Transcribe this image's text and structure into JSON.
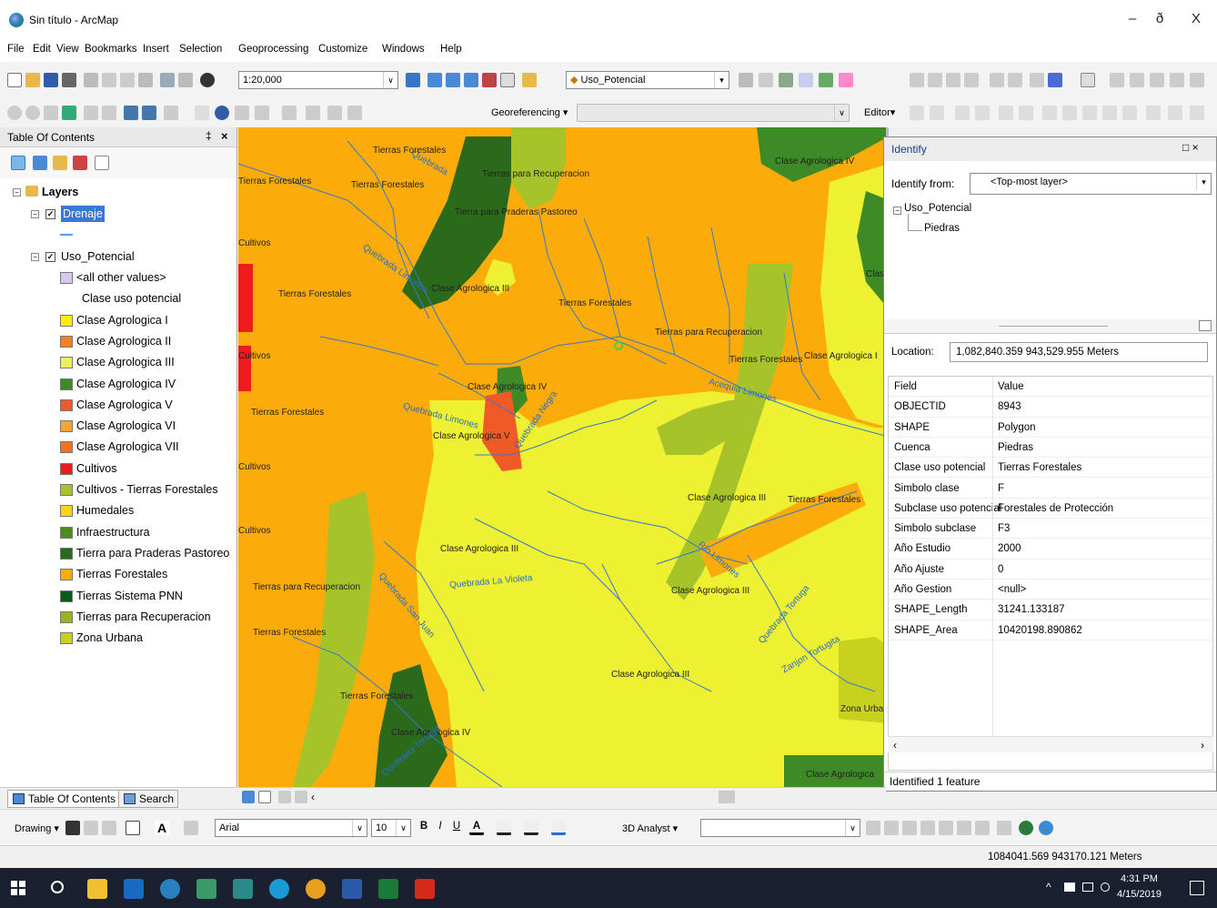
{
  "window": {
    "title": "Sin título - ArcMap",
    "minimize": "–",
    "maximize": "ð",
    "close": "X"
  },
  "menu": [
    "File",
    "Edit",
    "View",
    "Bookmarks",
    "Insert",
    "Selection",
    "Geoprocessing",
    "Customize",
    "Windows",
    "Help"
  ],
  "toolbar": {
    "scale": "1:20,000",
    "layer": "Uso_Potencial",
    "georef_label": "Georeferencing ▾",
    "editor_label": "Editor▾"
  },
  "toc": {
    "title": "Table Of Contents",
    "pin": "‡",
    "close": "×",
    "layers_label": "Layers",
    "layer1": "Drenaje",
    "layer2": "Uso_Potencial",
    "legend_heading": "Clase uso potencial",
    "legend": [
      {
        "label": "<all other values>",
        "color": "#d8c8f0"
      },
      {
        "label": "Clase Agrologica I",
        "color": "#ffee00"
      },
      {
        "label": "Clase Agrologica II",
        "color": "#f2821e"
      },
      {
        "label": "Clase Agrologica III",
        "color": "#e8f060"
      },
      {
        "label": "Clase Agrologica IV",
        "color": "#3d8a26"
      },
      {
        "label": "Clase Agrologica V",
        "color": "#f05a28"
      },
      {
        "label": "Clase Agrologica VI",
        "color": "#f7a23a"
      },
      {
        "label": "Clase Agrologica VII",
        "color": "#f0741e"
      },
      {
        "label": "Cultivos",
        "color": "#ee1c1c"
      },
      {
        "label": "Cultivos - Tierras Forestales",
        "color": "#a6c42a"
      },
      {
        "label": "Humedales",
        "color": "#ffd21e"
      },
      {
        "label": "Infraestructura",
        "color": "#4e8a1e"
      },
      {
        "label": "Tierra para Praderas Pastoreo",
        "color": "#2a6a1a"
      },
      {
        "label": "Tierras Forestales",
        "color": "#fbac0a"
      },
      {
        "label": "Tierras Sistema PNN",
        "color": "#0a5a1a"
      },
      {
        "label": "Tierras para Recuperacion",
        "color": "#9ab41e"
      },
      {
        "label": "Zona Urbana",
        "color": "#c8d21e"
      }
    ],
    "tab_toc": "Table Of Contents",
    "tab_search": "Search"
  },
  "map": {
    "labels": {
      "l1": "Tierras Forestales",
      "l2": "Tierras Forestales",
      "l3": "Tierras Forestales",
      "l4": "Tierras para Recuperacion",
      "l5": "Tierra para Praderas Pastoreo",
      "l6": "Clase Agrologica IV",
      "l7": "Cultivos",
      "l8": "Clase Agrologica III",
      "l9": "Tierras Forestales",
      "l10": "Tierras Forestales",
      "l11": "Cultivos",
      "l12": "Tierras para Recuperacion",
      "l13": "Tierras Forestales",
      "l14": "Clase Agrologica I",
      "l15": "Clase Agrologica IV",
      "l16": "Tierras Forestales",
      "l17": "Clase Agrologica V",
      "l18": "Cultivos",
      "l19": "Clase Agrologica III",
      "l20": "Tierras Forestales",
      "l21": "Cultivos",
      "l22": "Clase Agrologica III",
      "l23": "Tierras para Recuperacion",
      "l24": "Clase Agrologica III",
      "l25": "Tierras Forestales",
      "l26": "Clase Agrologica III",
      "l27": "Tierras Forestales",
      "l28": "Zona Urba",
      "l29": "Clase Agrologica IV",
      "l30": "Clase Agrologica",
      "l31": "Clas"
    },
    "rivers": {
      "r1": "Quebrada",
      "r2": "Quebrada Limones",
      "r3": "Quebrada Limones",
      "r4": "Quebrada Negra",
      "r5": "Acequia Limones",
      "r6": "Quebrada La Violeta",
      "r7": "Quebrada San Juan",
      "r8": "Río Limones",
      "r9": "Quebrada Tortuga",
      "r10": "Zanjon Tortugita",
      "r11": "Quebrada Tortuga"
    }
  },
  "identify": {
    "title": "Identify",
    "controls": "□ ×",
    "from_label": "Identify from:",
    "from_value": "<Top-most layer>",
    "tree_layer": "Uso_Potencial",
    "tree_feature": "Piedras",
    "location_label": "Location:",
    "location_value": "1,082,840.359  943,529.955 Meters",
    "columns": {
      "field": "Field",
      "value": "Value"
    },
    "rows": [
      {
        "field": "OBJECTID",
        "value": "8943"
      },
      {
        "field": "SHAPE",
        "value": "Polygon"
      },
      {
        "field": "Cuenca",
        "value": "Piedras"
      },
      {
        "field": "Clase uso potencial",
        "value": "Tierras Forestales"
      },
      {
        "field": "Simbolo clase",
        "value": "F"
      },
      {
        "field": "Subclase uso potencial",
        "value": "Forestales de Protección"
      },
      {
        "field": "Simbolo subclase",
        "value": "F3"
      },
      {
        "field": "Año Estudio",
        "value": "2000"
      },
      {
        "field": "Año Ajuste",
        "value": "0"
      },
      {
        "field": "Año Gestion",
        "value": "<null>"
      },
      {
        "field": "SHAPE_Length",
        "value": "31241.133187"
      },
      {
        "field": "SHAPE_Area",
        "value": "10420198.890862"
      }
    ],
    "status": "Identified 1 feature"
  },
  "drawing": {
    "label": "Drawing ▾",
    "font": "Arial",
    "size": "10",
    "analyst": "3D Analyst ▾"
  },
  "status": {
    "coords": "1084041.569  943170.121 Meters"
  },
  "taskbar": {
    "time": "4:31 PM",
    "date": "4/15/2019"
  }
}
